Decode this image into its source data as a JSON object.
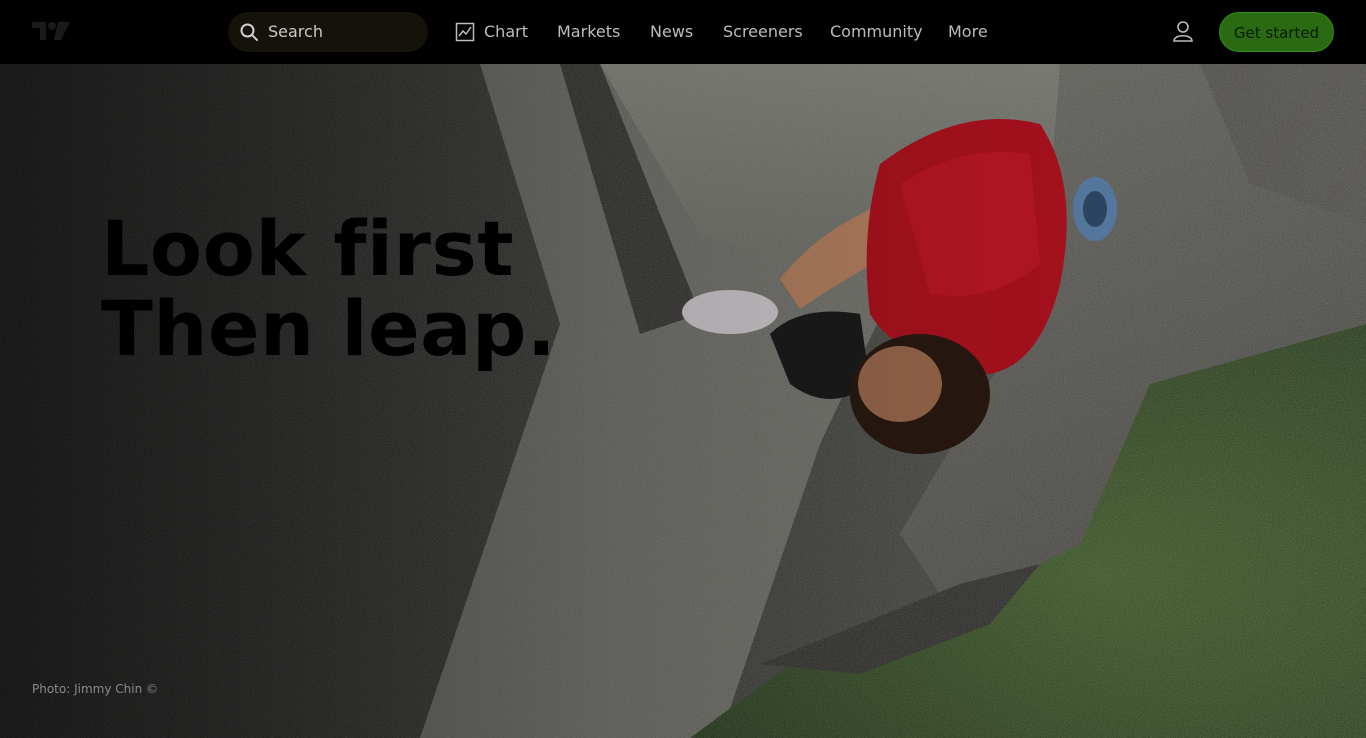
{
  "nav": {
    "logo": "TV",
    "search_placeholder": "Search",
    "items": [
      {
        "label": "Chart"
      },
      {
        "label": "Markets"
      },
      {
        "label": "News"
      },
      {
        "label": "Screeners"
      },
      {
        "label": "Community"
      },
      {
        "label": "More"
      }
    ],
    "cta": "Get started"
  },
  "hero": {
    "headline_line1": "Look first",
    "headline_line2": "Then leap.",
    "credit": "Photo: Jimmy Chin ©"
  },
  "colors": {
    "cta_background": "#2a6a12",
    "topbar_background": "#000000"
  }
}
